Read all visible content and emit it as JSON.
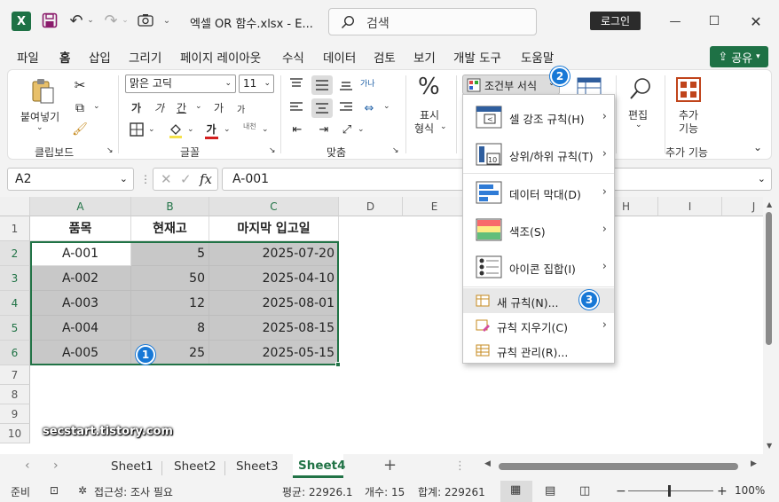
{
  "titlebar": {
    "filename": "엑셀 OR 함수.xlsx  -  E...",
    "search_placeholder": "검색",
    "login_label": "로그인",
    "minimize": "—",
    "maximize": "☐",
    "close": "✕"
  },
  "tabs": [
    "파일",
    "홈",
    "삽입",
    "그리기",
    "페이지 레이아웃",
    "수식",
    "데이터",
    "검토",
    "보기",
    "개발 도구",
    "도움말"
  ],
  "share_label": "공유",
  "ribbon": {
    "clipboard": {
      "paste_label": "붙여넣기",
      "group": "클립보드"
    },
    "font": {
      "name": "맑은 고딕",
      "size": "11",
      "group": "글꼴",
      "bold": "가",
      "italic": "가",
      "underline": "간",
      "grow": "가",
      "shrink": "가",
      "phonetic": "내천"
    },
    "align": {
      "group": "맞춤",
      "wrap": "가나"
    },
    "number": {
      "label_1": "표시",
      "label_2": "형식",
      "symbol": "%"
    },
    "conditional_label": "조건부 서식",
    "edit_label": "편집",
    "addins": {
      "label_1": "추가",
      "label_2": "기능",
      "group": "추가 기능"
    }
  },
  "namebox": "A2",
  "fx": "fx",
  "formula_value": "A-001",
  "columns": [
    "A",
    "B",
    "C",
    "D",
    "E",
    "F",
    "G",
    "H",
    "I",
    "J"
  ],
  "rows": [
    "1",
    "2",
    "3",
    "4",
    "5",
    "6",
    "7",
    "8",
    "9",
    "10"
  ],
  "table": {
    "headers": [
      "품목",
      "현재고",
      "마지막 입고일"
    ],
    "rows": [
      [
        "A-001",
        "5",
        "2025-07-20"
      ],
      [
        "A-002",
        "50",
        "2025-04-10"
      ],
      [
        "A-003",
        "12",
        "2025-08-01"
      ],
      [
        "A-004",
        "8",
        "2025-08-15"
      ],
      [
        "A-005",
        "25",
        "2025-05-15"
      ]
    ]
  },
  "menu": {
    "items": [
      {
        "label": "셀 강조 규칙(H)"
      },
      {
        "label": "상위/하위 규칙(T)"
      },
      {
        "label": "데이터 막대(D)"
      },
      {
        "label": "색조(S)"
      },
      {
        "label": "아이콘 집합(I)"
      }
    ],
    "small_items": [
      {
        "label": "새 규칙(N)..."
      },
      {
        "label": "규칙 지우기(C)"
      },
      {
        "label": "규칙 관리(R)..."
      }
    ]
  },
  "badges": [
    "1",
    "2",
    "3"
  ],
  "sheets": [
    "Sheet1",
    "Sheet2",
    "Sheet3",
    "Sheet4"
  ],
  "active_sheet": "Sheet4",
  "add_sheet": "+",
  "status": {
    "ready": "준비",
    "accessibility": "접근성: 조사 필요",
    "average": "평균: 22926.1",
    "count": "개수: 15",
    "sum": "합계: 229261",
    "zoom": "100%",
    "zoom_minus": "−",
    "zoom_plus": "+"
  },
  "watermark": "secstart.tistory.com",
  "colors": {
    "accent": "#217346",
    "badge": "#1778d6",
    "selection": "#c8c8c8"
  }
}
